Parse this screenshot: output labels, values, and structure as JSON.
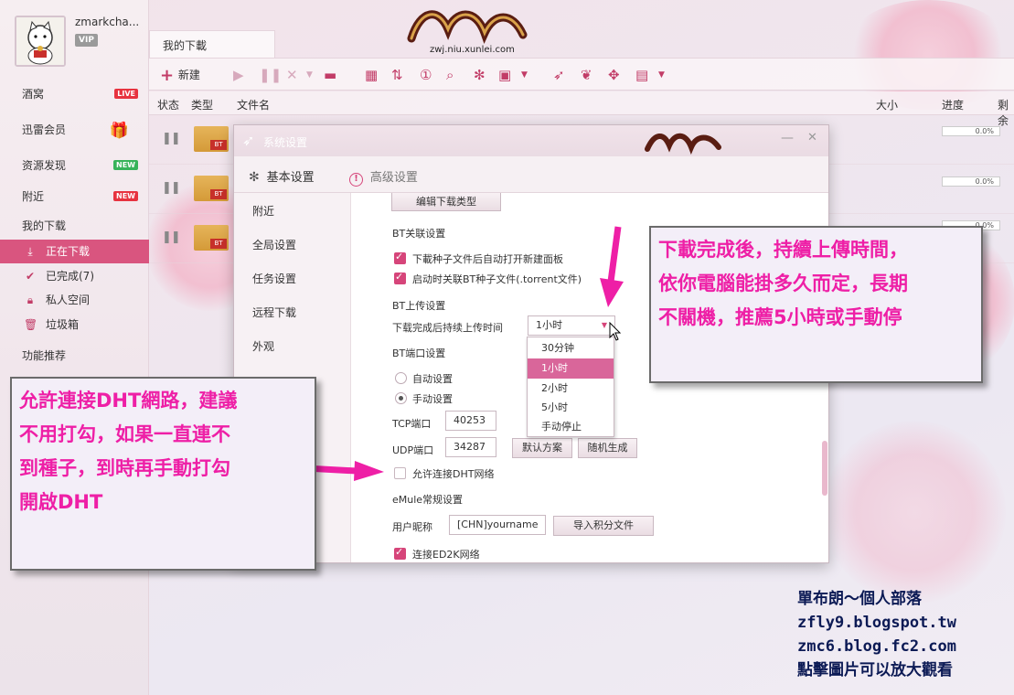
{
  "sidebar": {
    "username": "zmarkcha...",
    "vip": "VIP",
    "items": [
      {
        "label": "酒窝",
        "tag": "LIVE"
      },
      {
        "label": "迅雷会员"
      },
      {
        "label": "资源发现",
        "tag": "NEW"
      },
      {
        "label": "附近",
        "tag": "NEW"
      },
      {
        "label": "我的下载"
      },
      {
        "label": "正在下载"
      },
      {
        "label": "已完成(7)"
      },
      {
        "label": "私人空间"
      },
      {
        "label": "垃圾箱"
      },
      {
        "label": "功能推荐"
      }
    ]
  },
  "logo_text": "zwj.niu.xunlei.com",
  "tab": "我的下載",
  "toolbar": {
    "new_label": "新建"
  },
  "table": {
    "columns": [
      "状态",
      "类型",
      "文件名",
      "大小",
      "进度",
      "剩余"
    ],
    "rows": [
      {
        "type": "BT",
        "progress": "0.0%"
      },
      {
        "type": "BT",
        "progress": "0.0%"
      },
      {
        "type": "BT",
        "progress": "0.0%"
      }
    ]
  },
  "dialog": {
    "title": "系统设置",
    "tabs": [
      "基本设置",
      "高级设置"
    ],
    "nav": [
      "附近",
      "全局设置",
      "任务设置",
      "远程下载",
      "外观"
    ],
    "edit_type_button": "编辑下载类型",
    "bt_assoc_title": "BT关联设置",
    "bt_assoc_1": "下載种子文件后自动打开新建面板",
    "bt_assoc_2": "启动时关联BT种子文件(.torrent文件)",
    "bt_upload_title": "BT上传设置",
    "upload_label": "下载完成后持续上传时间",
    "upload_value": "1小时",
    "upload_options": [
      "30分钟",
      "1小时",
      "2小时",
      "5小时",
      "手动停止"
    ],
    "bt_port_title": "BT端口设置",
    "auto_setting": "自动设置",
    "manual_setting": "手动设置",
    "tcp_label": "TCP端口",
    "tcp_value": "40253",
    "udp_label": "UDP端口",
    "udp_value": "34287",
    "default_button": "默认方案",
    "random_button": "随机生成",
    "dht_label": "允许连接DHT网络",
    "emule_title": "eMule常规设置",
    "nickname_label": "用户昵称",
    "nickname_value": "[CHN]yourname",
    "import_button": "导入积分文件",
    "ed2k_label": "连接ED2K网络"
  },
  "callouts": {
    "right": [
      "下載完成後，持續上傳時間，",
      "依你電腦能掛多久而定，長期",
      "不關機，推薦5小時或手動停"
    ],
    "left": [
      "允許連接DHT網路，建議",
      "不用打勾，如果一直連不",
      "到種子，到時再手動打勾",
      "開啟DHT"
    ]
  },
  "watermark": [
    "單布朗～個人部落",
    "zfly9.blogspot.tw",
    "zmc6.blog.fc2.com",
    "點擊圖片可以放大觀看"
  ],
  "colors": {
    "accent": "#d9557f",
    "callout_text": "#ee1fa6",
    "arrow": "#ee1fa6"
  }
}
